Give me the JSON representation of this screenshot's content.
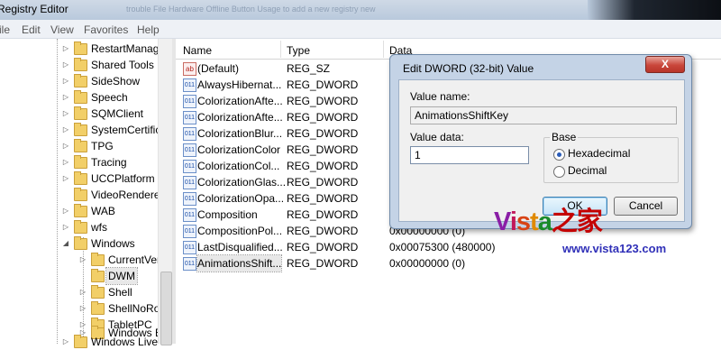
{
  "window": {
    "title": "Registry Editor",
    "title_tail": "trouble  File Hardware  Offline  Button  Usage  to  add  a  new  registry  new"
  },
  "menu": [
    "ile",
    "Edit",
    "View",
    "Favorites",
    "Help"
  ],
  "tree": {
    "items": [
      {
        "label": "RestartManage",
        "expander": "▷"
      },
      {
        "label": "Shared Tools",
        "expander": "▷"
      },
      {
        "label": "SideShow",
        "expander": "▷"
      },
      {
        "label": "Speech",
        "expander": "▷"
      },
      {
        "label": "SQMClient",
        "expander": "▷"
      },
      {
        "label": "SystemCertific",
        "expander": "▷"
      },
      {
        "label": "TPG",
        "expander": "▷"
      },
      {
        "label": "Tracing",
        "expander": "▷"
      },
      {
        "label": "UCCPlatform",
        "expander": "▷"
      },
      {
        "label": "VideoRenderer",
        "expander": ""
      },
      {
        "label": "WAB",
        "expander": "▷"
      },
      {
        "label": "wfs",
        "expander": "▷"
      },
      {
        "label": "Windows",
        "expander": "◢"
      },
      {
        "label": "CurrentVer",
        "expander": "▷"
      },
      {
        "label": "DWM",
        "expander": "",
        "selected": true
      },
      {
        "label": "Shell",
        "expander": "▷"
      },
      {
        "label": "ShellNoRo",
        "expander": "▷"
      },
      {
        "label": "TabletPC",
        "expander": "▷"
      },
      {
        "label": "Windows E",
        "expander": "▷"
      },
      {
        "label": "Windows Live",
        "expander": "▷"
      }
    ]
  },
  "list": {
    "columns": {
      "name": "Name",
      "type": "Type",
      "data": "Data"
    },
    "rows": [
      {
        "name": "(Default)",
        "type": "REG_SZ",
        "data": "",
        "icon": "ab"
      },
      {
        "name": "AlwaysHibernat...",
        "type": "REG_DWORD",
        "data": "",
        "icon": "011"
      },
      {
        "name": "ColorizationAfte...",
        "type": "REG_DWORD",
        "data": "",
        "icon": "011"
      },
      {
        "name": "ColorizationAfte...",
        "type": "REG_DWORD",
        "data": "",
        "icon": "011"
      },
      {
        "name": "ColorizationBlur...",
        "type": "REG_DWORD",
        "data": "",
        "icon": "011"
      },
      {
        "name": "ColorizationColor",
        "type": "REG_DWORD",
        "data": "",
        "icon": "011"
      },
      {
        "name": "ColorizationCol...",
        "type": "REG_DWORD",
        "data": "",
        "icon": "011"
      },
      {
        "name": "ColorizationGlas...",
        "type": "REG_DWORD",
        "data": "",
        "icon": "011"
      },
      {
        "name": "ColorizationOpa...",
        "type": "REG_DWORD",
        "data": "",
        "icon": "011"
      },
      {
        "name": "Composition",
        "type": "REG_DWORD",
        "data": "",
        "icon": "011"
      },
      {
        "name": "CompositionPol...",
        "type": "REG_DWORD",
        "data": "0x00000000 (0)",
        "icon": "011"
      },
      {
        "name": "LastDisqualified...",
        "type": "REG_DWORD",
        "data": "0x00075300 (480000)",
        "icon": "011"
      },
      {
        "name": "AnimationsShift...",
        "type": "REG_DWORD",
        "data": "0x00000000 (0)",
        "icon": "011",
        "selected": true
      }
    ]
  },
  "dialog": {
    "title": "Edit DWORD (32-bit) Value",
    "close": "X",
    "value_name_label": "Value name:",
    "value_name": "AnimationsShiftKey",
    "value_data_label": "Value data:",
    "value_data": "1",
    "base_label": "Base",
    "hex_label": "Hexadecimal",
    "dec_label": "Decimal",
    "base_selected": "Hexadecimal",
    "ok": "OK",
    "cancel": "Cancel"
  },
  "watermark": {
    "v": "V",
    "i": "i",
    "s": "s",
    "t": "t",
    "a": "a",
    "cn": "之家",
    "url": "www.vista123.com"
  }
}
